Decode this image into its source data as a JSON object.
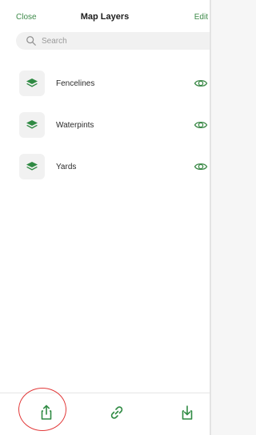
{
  "nav": {
    "close_label": "Close",
    "title": "Map Layers",
    "edit_label": "Edit"
  },
  "search": {
    "placeholder": "Search"
  },
  "layers": [
    {
      "name": "Fencelines",
      "icon": "layer-stack-icon",
      "visible": true
    },
    {
      "name": "Waterpints",
      "icon": "layer-stack-icon",
      "visible": true
    },
    {
      "name": "Yards",
      "icon": "layer-stack-icon",
      "visible": true
    }
  ],
  "toolbar": {
    "share_icon": "share-upload-icon",
    "link_icon": "link-icon",
    "download_icon": "download-icon"
  },
  "colors": {
    "accent": "#3d8a49",
    "highlight_circle": "#e23a3a"
  }
}
